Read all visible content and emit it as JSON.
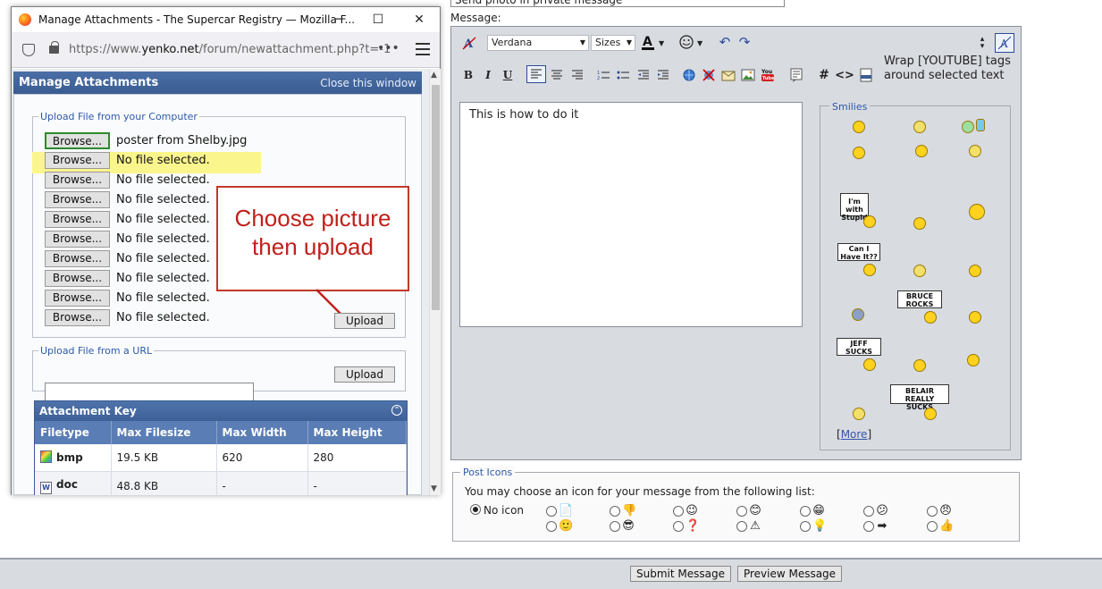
{
  "page": {
    "subject_value": "Send photo in private message",
    "message_label": "Message:",
    "editor": {
      "font_select": "Verdana",
      "size_select": "Sizes",
      "bold": "B",
      "italic": "I",
      "underline": "U",
      "hash_button": "#",
      "code_button": "<>",
      "wrap_tooltip": "Wrap [YOUTUBE] tags around selected text",
      "message_text": "This is how to do it"
    },
    "smilies": {
      "legend": "Smilies",
      "signs": {
        "im_with_stupid": "I'm with Stupid",
        "can_i_have_it": "Can I Have It??",
        "bruce_rocks": "BRUCE ROCKS",
        "jeff_sucks": "JEFF SUCKS",
        "belair_sucks": "BELAIR REALLY SUCKS"
      },
      "more_prefix": "[",
      "more_label": "More",
      "more_suffix": "]"
    },
    "post_icons": {
      "legend": "Post Icons",
      "description": "You may choose an icon for your message from the following list:",
      "no_icon_label": "No icon",
      "icons_row1": [
        "📄",
        "👎",
        "😉",
        "😊",
        "😁",
        "😕",
        "😠"
      ],
      "icons_row2": [
        "🙂",
        "😎",
        "❓",
        "⚠",
        "💡",
        "➡",
        "👍"
      ]
    },
    "buttons": {
      "submit": "Submit Message",
      "preview": "Preview Message"
    }
  },
  "popup": {
    "window_title": "Manage Attachments - The Supercar Registry — Mozilla F...",
    "url_prefix": "https://www.",
    "url_domain": "yenko.net",
    "url_path": "/forum/newattachment.php?t=-1",
    "url_more": "•••",
    "header_title": "Manage Attachments",
    "close_link": "Close this window",
    "upload_computer_legend": "Upload File from your Computer",
    "browse_label": "Browse...",
    "file_rows": [
      "poster from Shelby.jpg",
      "No file selected.",
      "No file selected.",
      "No file selected.",
      "No file selected.",
      "No file selected.",
      "No file selected.",
      "No file selected.",
      "No file selected.",
      "No file selected."
    ],
    "upload_label": "Upload",
    "callout_line1": "Choose picture",
    "callout_line2": "then upload",
    "upload_url_legend": "Upload File from a URL",
    "url_input_value": "",
    "attachment_key": {
      "title": "Attachment Key",
      "headers": [
        "Filetype",
        "Max Filesize",
        "Max Width",
        "Max Height"
      ],
      "rows": [
        [
          "bmp",
          "19.5 KB",
          "620",
          "280"
        ],
        [
          "doc",
          "48.8 KB",
          "-",
          "-"
        ]
      ]
    }
  },
  "colors": {
    "highlight": "#fbf58d",
    "callout_red": "#c0201a",
    "header_blue": "#3a5c92"
  }
}
